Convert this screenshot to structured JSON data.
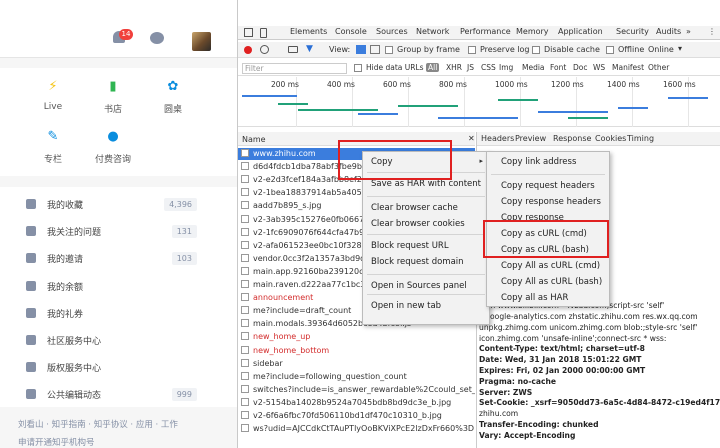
{
  "zhihu": {
    "notif_count": "14",
    "quick": [
      {
        "label": "Live",
        "icon": "lightning-icon",
        "color": "#f5c518"
      },
      {
        "label": "书店",
        "icon": "book-icon",
        "color": "#2fb552"
      },
      {
        "label": "圆桌",
        "icon": "roundtable-icon",
        "color": "#0a8dde"
      },
      {
        "label": "专栏",
        "icon": "pen-icon",
        "color": "#0a8dde"
      },
      {
        "label": "付费咨询",
        "icon": "chat-icon",
        "color": "#0a8dde"
      }
    ],
    "menu": [
      {
        "label": "我的收藏",
        "count": "4,396",
        "icon": "star-icon"
      },
      {
        "label": "我关注的问题",
        "count": "131",
        "icon": "question-icon"
      },
      {
        "label": "我的邀请",
        "count": "103",
        "icon": "invite-icon"
      },
      {
        "label": "我的余额",
        "count": "",
        "icon": "wallet-icon"
      },
      {
        "label": "我的礼券",
        "count": "",
        "icon": "coupon-icon"
      },
      {
        "label": "社区服务中心",
        "count": "",
        "icon": "community-icon"
      },
      {
        "label": "版权服务中心",
        "count": "",
        "icon": "copyright-icon"
      },
      {
        "label": "公共编辑动态",
        "count": "999",
        "icon": "edit-icon"
      }
    ],
    "footer1": "刘看山 · 知乎指南 · 知乎协议 · 应用 · 工作",
    "footer2": "申请开通知乎机构号"
  },
  "devtools": {
    "tabs": [
      "Elements",
      "Console",
      "Sources",
      "Network",
      "Performance",
      "Memory",
      "Application",
      "Security",
      "Audits"
    ],
    "more": "»",
    "toolbar": {
      "view": "View:",
      "group_by_frame": "Group by frame",
      "preserve_log": "Preserve log",
      "disable_cache": "Disable cache",
      "offline": "Offline",
      "throttle": "Online"
    },
    "filter_placeholder": "Filter",
    "hide_data_urls": "Hide data URLs",
    "filter_types": [
      "All",
      "XHR",
      "JS",
      "CSS",
      "Img",
      "Media",
      "Font",
      "Doc",
      "WS",
      "Manifest",
      "Other"
    ],
    "timeline_ticks": [
      "200 ms",
      "400 ms",
      "600 ms",
      "800 ms",
      "1000 ms",
      "1200 ms",
      "1400 ms",
      "1600 ms"
    ],
    "name_header": "Name",
    "requests": [
      {
        "name": "www.zhihu.com",
        "red": false,
        "selected": true
      },
      {
        "name": "d6d4fdcb1dba78abf3fbe9bc",
        "red": false
      },
      {
        "name": "v2-e2d3fcef184a3afbb8ef227",
        "red": false
      },
      {
        "name": "v2-1bea18837914ab5a40537",
        "red": false
      },
      {
        "name": "aadd7b895_s.jpg",
        "red": false
      },
      {
        "name": "v2-3ab395c15276e0fb06675",
        "red": false
      },
      {
        "name": "v2-1fc6909076f644cfa47b9f",
        "red": false
      },
      {
        "name": "v2-afa061523ee0bc10f3281",
        "red": false
      },
      {
        "name": "vendor.0cc3f2a1357a3bd9d",
        "red": false
      },
      {
        "name": "main.app.92160ba239120ce",
        "red": false
      },
      {
        "name": "main.raven.d222aa77c1bc35",
        "red": false
      },
      {
        "name": "announcement",
        "red": true
      },
      {
        "name": "me?include=draft_count",
        "red": false
      },
      {
        "name": "main.modals.39364d6052bc8a4bfc8f.js",
        "red": false
      },
      {
        "name": "new_home_up",
        "red": true
      },
      {
        "name": "new_home_bottom",
        "red": true
      },
      {
        "name": "sidebar",
        "red": false
      },
      {
        "name": "me?include=following_question_count",
        "red": false
      },
      {
        "name": "switches?include=is_answer_rewardable%2Ccould_set_po...",
        "red": false
      },
      {
        "name": "v2-5154ba14028b9524a7045bdb8bd9dc3e_b.jpg",
        "red": false
      },
      {
        "name": "v2-6f6a6fbc70fd506110bd1df470c10310_b.jpg",
        "red": false
      },
      {
        "name": "ws?udid=AJCCdkCtTAuPTlyOoBKViXPcE2lzDxFr660%3D",
        "red": false
      }
    ],
    "right_tabs": [
      "Headers",
      "Preview",
      "Response",
      "Cookies",
      "Timing"
    ],
    "header_lines": [
      {
        "text": "",
        "bold": false
      },
      {
        "text": "                                         om/",
        "bold": false
      },
      {
        "text": "",
        "bold": false
      },
      {
        "text": "",
        "bold": false
      },
      {
        "text": "                                         43",
        "bold": false
      },
      {
        "text": "                                         n-downgrade",
        "bold": false
      },
      {
        "text": "",
        "bold": false
      },
      {
        "text": "",
        "bold": false
      },
      {
        "text": "                                  ,max-age=0,no-cache,must-",
        "bold": false
      },
      {
        "text": "",
        "bold": false
      },
      {
        "text": "",
        "bold": false
      },
      {
        "text": "                               -src * blob:;img-src * dat",
        "bold": false
      },
      {
        "text": "                           et.com note.youdao.com saf",
        "bold": false
      },
      {
        "text": "                     -Q79wDk8YH9 weixin: zhih",
        "bold": false
      },
      {
        "text": "com www.bilibili.com * .vzuu.com;script-src 'self'",
        "bold": false
      },
      {
        "text": "*.google-analytics.com zhstatic.zhihu.com res.wx.qq.com",
        "bold": false
      },
      {
        "text": "unpkg.zhimg.com unicom.zhimg.com blob:;style-src 'self'",
        "bold": false
      },
      {
        "text": "icon.zhimg.com 'unsafe-inline';connect-src * wss:",
        "bold": false
      },
      {
        "text": "Content-Type: text/html; charset=utf-8",
        "bold": true
      },
      {
        "text": "Date: Wed, 31 Jan 2018 15:01:22 GMT",
        "bold": true
      },
      {
        "text": "Expires: Fri, 02 Jan 2000 00:00:00 GMT",
        "bold": true
      },
      {
        "text": "Pragma: no-cache",
        "bold": true
      },
      {
        "text": "Server: ZWS",
        "bold": true
      },
      {
        "text": "Set-Cookie: _xsrf=9050dd73-6a5c-4d84-8472-c19ed4f17888;",
        "bold": true
      },
      {
        "text": "zhihu.com",
        "bold": false
      },
      {
        "text": "Transfer-Encoding: chunked",
        "bold": true
      },
      {
        "text": "Vary: Accept-Encoding",
        "bold": true
      }
    ]
  },
  "context_menu": {
    "items": [
      "Copy",
      "Save as HAR with content",
      "Clear browser cache",
      "Clear browser cookies",
      "Block request URL",
      "Block request domain",
      "Open in Sources panel",
      "Open in new tab"
    ],
    "arrow": "▸"
  },
  "copy_submenu": {
    "items": [
      "Copy link address",
      "Copy request headers",
      "Copy response headers",
      "Copy response",
      "Copy as cURL (cmd)",
      "Copy as cURL (bash)",
      "Copy All as cURL (cmd)",
      "Copy All as cURL (bash)",
      "Copy all as HAR"
    ]
  }
}
